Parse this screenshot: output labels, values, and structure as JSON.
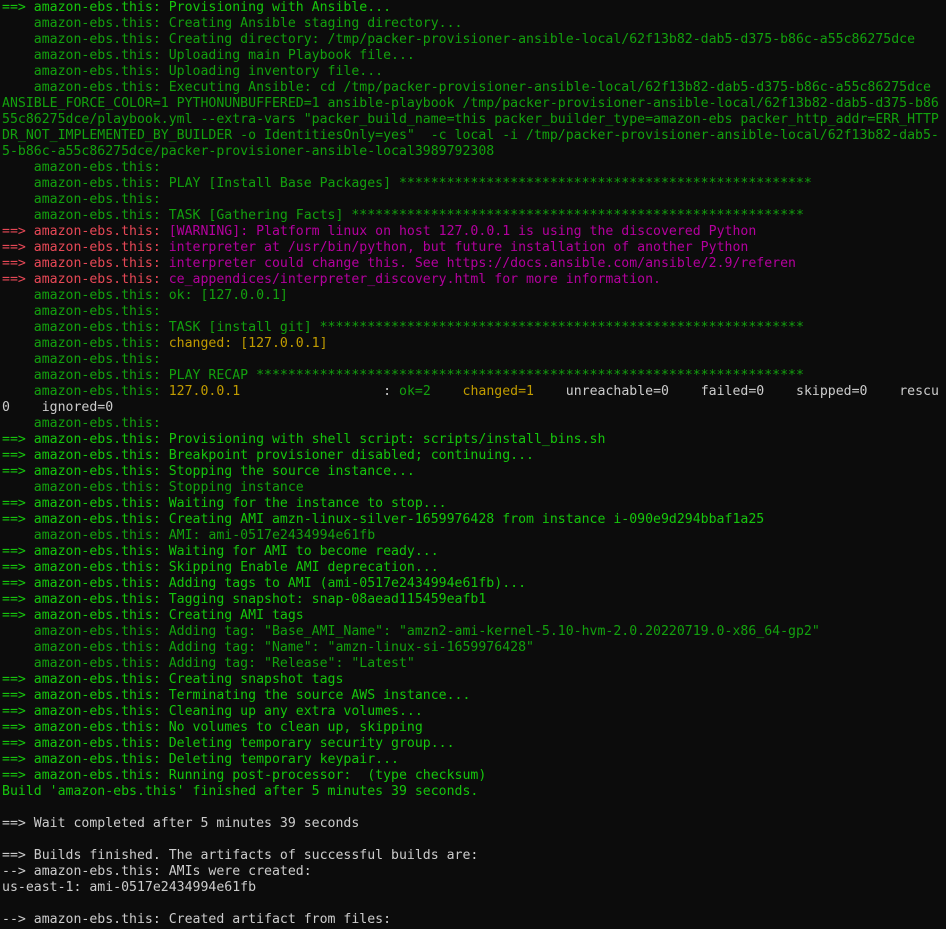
{
  "terminal": {
    "lines": [
      [
        {
          "t": "==> amazon-ebs.this: Provisioning with Ansible...",
          "c": "bgreen"
        }
      ],
      [
        {
          "t": "    amazon-ebs.this: Creating Ansible staging directory...",
          "c": "green"
        }
      ],
      [
        {
          "t": "    amazon-ebs.this: Creating directory: /tmp/packer-provisioner-ansible-local/62f13b82-dab5-d375-b86c-a55c86275dce",
          "c": "green"
        }
      ],
      [
        {
          "t": "    amazon-ebs.this: Uploading main Playbook file...",
          "c": "green"
        }
      ],
      [
        {
          "t": "    amazon-ebs.this: Uploading inventory file...",
          "c": "green"
        }
      ],
      [
        {
          "t": "    amazon-ebs.this: Executing Ansible: cd /tmp/packer-provisioner-ansible-local/62f13b82-dab5-d375-b86c-a55c86275dce",
          "c": "green"
        }
      ],
      [
        {
          "t": "ANSIBLE_FORCE_COLOR=1 PYTHONUNBUFFERED=1 ansible-playbook /tmp/packer-provisioner-ansible-local/62f13b82-dab5-d375-b86",
          "c": "green"
        }
      ],
      [
        {
          "t": "55c86275dce/playbook.yml --extra-vars \"packer_build_name=this packer_builder_type=amazon-ebs packer_http_addr=ERR_HTTP",
          "c": "green"
        }
      ],
      [
        {
          "t": "DR_NOT_IMPLEMENTED_BY_BUILDER -o IdentitiesOnly=yes\"  -c local -i /tmp/packer-provisioner-ansible-local/62f13b82-dab5-",
          "c": "green"
        }
      ],
      [
        {
          "t": "5-b86c-a55c86275dce/packer-provisioner-ansible-local3989792308",
          "c": "green"
        }
      ],
      [
        {
          "t": "    amazon-ebs.this:",
          "c": "green"
        }
      ],
      [
        {
          "t": "    amazon-ebs.this: PLAY [Install Base Packages] ****************************************************",
          "c": "green"
        }
      ],
      [
        {
          "t": "    amazon-ebs.this:",
          "c": "green"
        }
      ],
      [
        {
          "t": "    amazon-ebs.this: TASK [Gathering Facts] *********************************************************",
          "c": "green"
        }
      ],
      [
        {
          "t": "==> amazon-ebs.this: ",
          "c": "red"
        },
        {
          "t": "[WARNING]: Platform linux on host 127.0.0.1 is using the discovered Python",
          "c": "magenta"
        }
      ],
      [
        {
          "t": "==> amazon-ebs.this: ",
          "c": "red"
        },
        {
          "t": "interpreter at /usr/bin/python, but future installation of another Python",
          "c": "magenta"
        }
      ],
      [
        {
          "t": "==> amazon-ebs.this: ",
          "c": "red"
        },
        {
          "t": "interpreter could change this. See https://docs.ansible.com/ansible/2.9/referen",
          "c": "magenta"
        }
      ],
      [
        {
          "t": "==> amazon-ebs.this: ",
          "c": "red"
        },
        {
          "t": "ce_appendices/interpreter_discovery.html for more information.",
          "c": "magenta"
        }
      ],
      [
        {
          "t": "    amazon-ebs.this: ok: [127.0.0.1]",
          "c": "green"
        }
      ],
      [
        {
          "t": "    amazon-ebs.this:",
          "c": "green"
        }
      ],
      [
        {
          "t": "    amazon-ebs.this: TASK [install git] *************************************************************",
          "c": "green"
        }
      ],
      [
        {
          "t": "    amazon-ebs.this: ",
          "c": "green"
        },
        {
          "t": "changed: [127.0.0.1]",
          "c": "yellow"
        }
      ],
      [
        {
          "t": "    amazon-ebs.this:",
          "c": "green"
        }
      ],
      [
        {
          "t": "    amazon-ebs.this: PLAY RECAP *********************************************************************",
          "c": "green"
        }
      ],
      [
        {
          "t": "    amazon-ebs.this: ",
          "c": "green"
        },
        {
          "t": "127.0.0.1",
          "c": "yellow"
        },
        {
          "t": "                  : ",
          "c": "white"
        },
        {
          "t": "ok=2",
          "c": "green"
        },
        {
          "t": "    ",
          "c": "white"
        },
        {
          "t": "changed=1",
          "c": "yellow"
        },
        {
          "t": "    unreachable=0    failed=0    skipped=0    rescu",
          "c": "white"
        }
      ],
      [
        {
          "t": "0    ignored=0",
          "c": "white"
        }
      ],
      [
        {
          "t": "    amazon-ebs.this:",
          "c": "green"
        }
      ],
      [
        {
          "t": "==> amazon-ebs.this: Provisioning with shell script: scripts/install_bins.sh",
          "c": "bgreen"
        }
      ],
      [
        {
          "t": "==> amazon-ebs.this: Breakpoint provisioner disabled; continuing...",
          "c": "bgreen"
        }
      ],
      [
        {
          "t": "==> amazon-ebs.this: Stopping the source instance...",
          "c": "bgreen"
        }
      ],
      [
        {
          "t": "    amazon-ebs.this: Stopping instance",
          "c": "green"
        }
      ],
      [
        {
          "t": "==> amazon-ebs.this: Waiting for the instance to stop...",
          "c": "bgreen"
        }
      ],
      [
        {
          "t": "==> amazon-ebs.this: Creating AMI amzn-linux-silver-1659976428 from instance i-090e9d294bbaf1a25",
          "c": "bgreen"
        }
      ],
      [
        {
          "t": "    amazon-ebs.this: AMI: ami-0517e2434994e61fb",
          "c": "green"
        }
      ],
      [
        {
          "t": "==> amazon-ebs.this: Waiting for AMI to become ready...",
          "c": "bgreen"
        }
      ],
      [
        {
          "t": "==> amazon-ebs.this: Skipping Enable AMI deprecation...",
          "c": "bgreen"
        }
      ],
      [
        {
          "t": "==> amazon-ebs.this: Adding tags to AMI (ami-0517e2434994e61fb)...",
          "c": "bgreen"
        }
      ],
      [
        {
          "t": "==> amazon-ebs.this: Tagging snapshot: snap-08aead115459eafb1",
          "c": "bgreen"
        }
      ],
      [
        {
          "t": "==> amazon-ebs.this: Creating AMI tags",
          "c": "bgreen"
        }
      ],
      [
        {
          "t": "    amazon-ebs.this: Adding tag: \"Base_AMI_Name\": \"amzn2-ami-kernel-5.10-hvm-2.0.20220719.0-x86_64-gp2\"",
          "c": "green"
        }
      ],
      [
        {
          "t": "    amazon-ebs.this: Adding tag: \"Name\": \"amzn-linux-si-1659976428\"",
          "c": "green"
        }
      ],
      [
        {
          "t": "    amazon-ebs.this: Adding tag: \"Release\": \"Latest\"",
          "c": "green"
        }
      ],
      [
        {
          "t": "==> amazon-ebs.this: Creating snapshot tags",
          "c": "bgreen"
        }
      ],
      [
        {
          "t": "==> amazon-ebs.this: Terminating the source AWS instance...",
          "c": "bgreen"
        }
      ],
      [
        {
          "t": "==> amazon-ebs.this: Cleaning up any extra volumes...",
          "c": "bgreen"
        }
      ],
      [
        {
          "t": "==> amazon-ebs.this: No volumes to clean up, skipping",
          "c": "bgreen"
        }
      ],
      [
        {
          "t": "==> amazon-ebs.this: Deleting temporary security group...",
          "c": "bgreen"
        }
      ],
      [
        {
          "t": "==> amazon-ebs.this: Deleting temporary keypair...",
          "c": "bgreen"
        }
      ],
      [
        {
          "t": "==> amazon-ebs.this: Running post-processor:  (type checksum)",
          "c": "bgreen"
        }
      ],
      [
        {
          "t": "Build 'amazon-ebs.this' finished after 5 minutes 39 seconds.",
          "c": "bgreen"
        }
      ],
      [
        {
          "t": "",
          "c": "white"
        }
      ],
      [
        {
          "t": "==> Wait completed after 5 minutes 39 seconds",
          "c": "white"
        }
      ],
      [
        {
          "t": "",
          "c": "white"
        }
      ],
      [
        {
          "t": "==> Builds finished. The artifacts of successful builds are:",
          "c": "white"
        }
      ],
      [
        {
          "t": "--> amazon-ebs.this: AMIs were created:",
          "c": "white"
        }
      ],
      [
        {
          "t": "us-east-1: ami-0517e2434994e61fb",
          "c": "white"
        }
      ],
      [
        {
          "t": "",
          "c": "white"
        }
      ],
      [
        {
          "t": "--> amazon-ebs.this: Created artifact from files:",
          "c": "white"
        }
      ]
    ]
  }
}
